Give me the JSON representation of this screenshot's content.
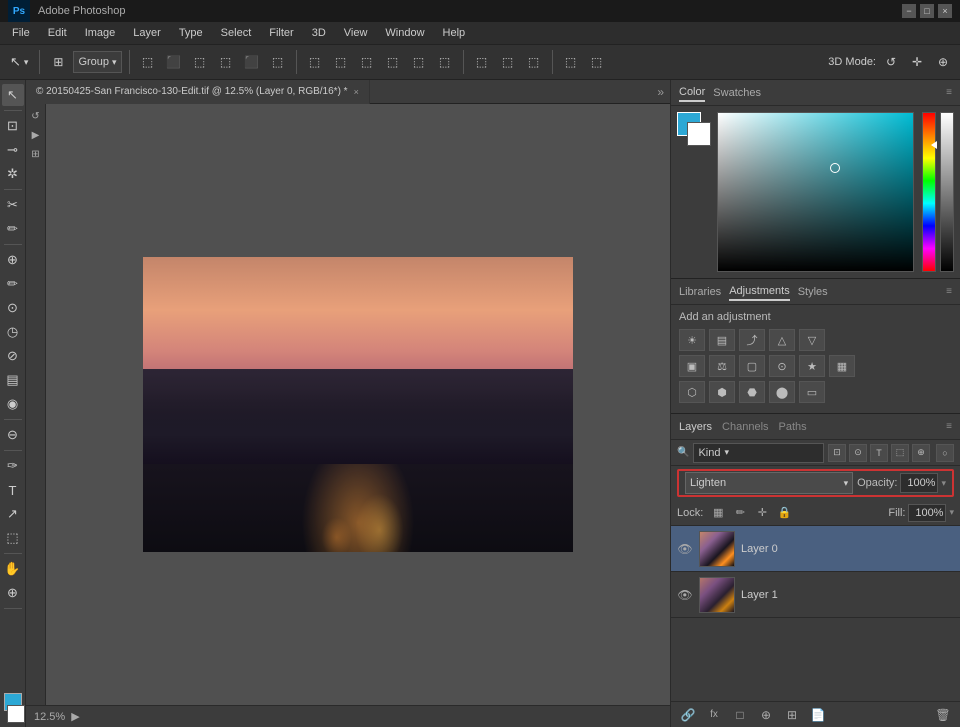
{
  "titlebar": {
    "logo": "Ps",
    "title": "Adobe Photoshop",
    "controls": [
      "−",
      "□",
      "×"
    ]
  },
  "menubar": {
    "items": [
      "File",
      "Edit",
      "Image",
      "Layer",
      "Type",
      "Select",
      "Filter",
      "3D",
      "View",
      "Window",
      "Help"
    ]
  },
  "toolbar": {
    "group_label": "Group",
    "mode_label": "3D Mode:",
    "arrange_btn": "▤",
    "dropdown_arrow": "▾"
  },
  "tools": {
    "items": [
      "↖",
      "⊡",
      "⊖",
      "⊗",
      "✂",
      "+",
      "✏",
      "⬚",
      "♦",
      "✐",
      "⬓",
      "⬭",
      "◐",
      "⊘",
      "∇",
      "T",
      "↗"
    ]
  },
  "tab": {
    "filename": "© 20150425-San Francisco-130-Edit.tif @ 12.5% (Layer 0, RGB/16*) *",
    "close": "×"
  },
  "status": {
    "zoom": "12.5%",
    "arrow": "▶"
  },
  "colorpanel": {
    "tabs": [
      "Color",
      "Swatches"
    ],
    "active_tab": "Color",
    "fg_color": "#2ca8d5",
    "bg_color": "#ffffff"
  },
  "adjustments": {
    "tabs": [
      "Libraries",
      "Adjustments",
      "Styles"
    ],
    "active_tab": "Adjustments",
    "title": "Add an adjustment",
    "icons_row1": [
      "☀",
      "▤",
      "⬚",
      "△",
      "▽"
    ],
    "icons_row2": [
      "▣",
      "⚖",
      "▢",
      "📷",
      "★",
      "▦"
    ],
    "icons_row3": [
      "⬡",
      "⬢",
      "⬣",
      "⬤",
      "▭"
    ]
  },
  "layers": {
    "tabs": [
      "Layers",
      "Channels",
      "Paths"
    ],
    "active_tab": "Layers",
    "search_placeholder": "Kind",
    "blend_mode": "Lighten",
    "opacity_label": "Opacity:",
    "opacity_value": "100%",
    "lock_label": "Lock:",
    "fill_label": "Fill:",
    "fill_value": "100%",
    "items": [
      {
        "name": "Layer 0",
        "visible": true,
        "selected": true
      },
      {
        "name": "Layer 1",
        "visible": true,
        "selected": false
      }
    ],
    "bottom_icons": [
      "🔗",
      "fx",
      "□",
      "⊕",
      "🗑"
    ]
  }
}
